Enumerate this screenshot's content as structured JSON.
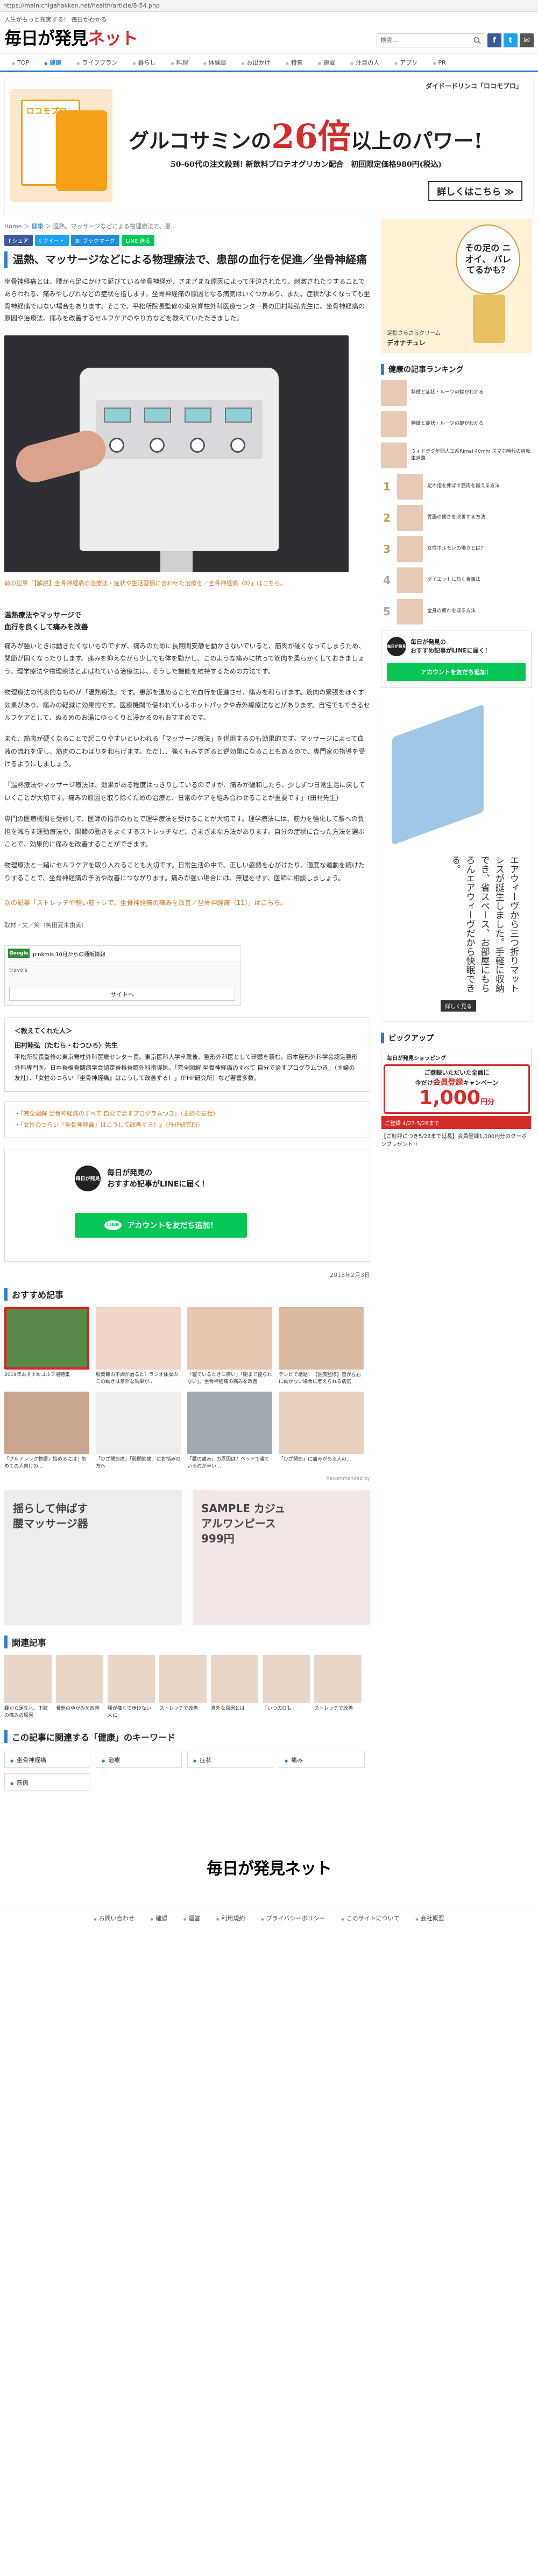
{
  "browser": {
    "url": "https://mainichigahakken.net/health/article/8-54.php"
  },
  "header": {
    "tagline": "人生がもっと充実する！ 毎日がわかる",
    "logo_main": "毎日が発見",
    "logo_accent": "ネット",
    "search_placeholder": "検索...",
    "social": [
      "f",
      "t",
      "✉"
    ]
  },
  "nav": {
    "items": [
      "TOP",
      "健康",
      "ライフプラン",
      "暮らし",
      "料理",
      "体験談",
      "お出かけ",
      "特集",
      "連載",
      "注目の人",
      "アプリ",
      "PR"
    ],
    "active_index": 1
  },
  "top_ad": {
    "brand": "ダイドードリンコ「ロコモプロ」",
    "product": "ロコモプロ",
    "headline_pre": "グルコサミンの",
    "headline_big": "26倍",
    "headline_post": "以上のパワー!",
    "sub": "50-60代の注文殺到! 新飲料プロテオグリカン配合　初回限定価格980円(税込)",
    "more": "詳しくはこちら ≫"
  },
  "breadcrumb": {
    "home": "Home",
    "sep1": "＞",
    "cat": "健康",
    "sep2": "＞",
    "current": "温熱、マッサージなどによる物理療法で、患..."
  },
  "share": {
    "buttons": [
      "f シェア",
      "t ツイート",
      "B! ブックマーク",
      "LINE 送る"
    ],
    "colors": [
      "#3b5998",
      "#1da1f2",
      "#1f8ddb",
      "#06c755"
    ]
  },
  "article": {
    "title": "温熱、マッサージなどによる物理療法で、患部の血行を促進／坐骨神経痛",
    "lead": "坐骨神経痛とは、腰から足にかけて延びている坐骨神経が、さまざまな原因によって圧迫されたり、刺激されたりすることであらわれる、痛みやしびれなどの症状を指します。坐骨神経痛の原因となる病気はいくつかあり、また、症状がよくなっても坐骨神経痛ではない場合もあります。そこで、平松所院長監修の東京脊柱外科医療センター長の田村睦弘先生に、坐骨神経痛の原因や治療法、痛みを改善するセルフケアのやり方などを教えていただきました。",
    "caption": "前の記事「【解説】坐骨神経痛の治療法・症状や生活習慣に合わせた治療を／坐骨神経痛（8）」はこちら。",
    "section_heading": "温熱療法やマッサージで\n血行を良くして痛みを改善",
    "paragraphs": [
      "痛みが強いときは動きたくないものですが、痛みのために長期間安静を動かさないでいると、筋肉が硬くなってしまうため、関節が固くなったりします。痛みを抑えながら少しでも体を動かし、このような痛みに抗って筋肉を柔らかくしておきましょう。理学療法や物理療法とよばれている治療法は、そうした機能を維持するための方法です。",
      "物理療法の代表的なものが「温熱療法」です。患部を温めることで血行を促進させ、痛みを和らげます。筋肉の緊張をほぐす効果があり、痛みの軽減に効果的です。医療機関で使われているホットパックや赤外線療法などがあります。自宅でもできるセルフケアとして、ぬるめのお湯にゆっくりと浸かるのもおすすめです。",
      "また、筋肉が硬くなることで起こりやすいといわれる「マッサージ療法」を併用するのも効果的です。マッサージによって血液の流れを促し、筋肉のこわばりを和らげます。ただし、強くもみすぎると逆効果になることもあるので、専門家の指導を受けるようにしましょう。",
      "「温熱療法やマッサージ療法は、効果がある程度はっきりしているのですが、痛みが緩和したら、少しずつ日常生活に戻していくことが大切です。痛みの原因を取り除くための治療と、日常のケアを組み合わせることが重要です」（田村先生）",
      "専門の医療機関を受診して、医師の指示のもとで理学療法を受けることが大切です。理学療法には、筋力を強化して腰への負担を減らす運動療法や、関節の動きをよくするストレッチなど、さまざまな方法があります。自分の症状に合った方法を選ぶことで、効果的に痛みを改善することができます。",
      "物理療法と一緒にセルフケアを取り入れることも大切です。日常生活の中で、正しい姿勢を心がけたり、適度な運動を続けたりすることで、坐骨神経痛の予防や改善につながります。痛みが強い場合には、無理をせず、医師に相談しましょう。"
    ],
    "next_link": "次の記事「ストレッチや軽い筋トレで、坐骨神経痛の痛みを改善／坐骨神経痛（11）」はこちら。",
    "source": "取材・文／笑（笑田夏木由美）"
  },
  "inline_ad": {
    "brand": "Google",
    "title": "pinkmis 10月からの通販情報",
    "url": "travels",
    "button": "サイトへ"
  },
  "expert": {
    "heading": "＜教えてくれた人＞",
    "name": "田村睦弘（たむら・むつひろ）先生",
    "bio": "平松所院長監修の東京脊柱外科医療センター長。東京医科大学卒業後、整形外科医として研鑽を積む。日本整形外科学会認定整形外科専門医。日本脊椎脊髄病学会認定脊椎脊髄外科指導医。「完全図解 坐骨神経痛のすべて 自分で治すプログラムつき」（主婦の友社）、「女性のつらい『坐骨神経痛』はこうして改善する！」（PHP研究所）など著書多数。"
  },
  "books": [
    "『完全図解 坐骨神経痛のすべて 自分で治すプログラムつき』（主婦の友社）",
    "『女性のつらい「坐骨神経痛」はこうして改善する！』（PHP研究所）"
  ],
  "line_box": {
    "icon": "毎日が発見",
    "text": "毎日が発見の\nおすすめ記事がLINEに届く！",
    "button": "アカウントを友だち追加！",
    "line_label": "LINE"
  },
  "date": "2018年2月3日",
  "recommend": {
    "title": "おすすめ記事",
    "items": [
      {
        "text": "2019年おすすめゴルフ場特集",
        "src": "",
        "color": "#5a8a4a"
      },
      {
        "text": "股関節の不調が治ると？ラジオ体操のこの動きは意外な効果が…",
        "src": "",
        "color": "#f0d5c8"
      },
      {
        "text": "「寝ているときに痛い」「朝まで寝られない」。坐骨神経痛の痛みを改善",
        "src": "",
        "color": "#e8c4b0"
      },
      {
        "text": "テレビで話題！【医療監修】首が左右に動かない場合に考えられる病気",
        "src": "",
        "color": "#d9b8a0"
      },
      {
        "text": "「ブルアレック物語」始めるには？初めての人向けの...",
        "src": "",
        "color": "#c9a48e"
      },
      {
        "text": "「ひざ関節痛」「股関節痛」にお悩みの方へ",
        "src": "",
        "color": "#eeeeee"
      },
      {
        "text": "「腰の痛み」の原因は？ベッドで寝ているのが辛い...",
        "src": "",
        "color": "#a0a8b0"
      },
      {
        "text": "「ひざ関節」に痛みがある人の...",
        "src": "",
        "color": "#e6d0c0"
      }
    ],
    "note": "Recommended by"
  },
  "big_ads": [
    {
      "text": "揺らして伸ばす 腰マッサージ器",
      "color": "#ededed"
    },
    {
      "text": "SAMPLE カジュアルワンピース 999円",
      "color": "#f3e6e6"
    }
  ],
  "related": {
    "title": "関連記事",
    "items": [
      "腰から足先へ。下肢の痛みの原因",
      "骨盤のゆがみを改善",
      "腰が痛くて歩けない人に",
      "ストレッチで改善",
      "意外な原因とは",
      "「いつの日も」",
      "ストレッチで改善"
    ]
  },
  "keywords": {
    "title": "この記事に関連する「健康」のキーワード",
    "items": [
      "坐骨神経痛",
      "治療",
      "症状",
      "痛み",
      "筋肉"
    ]
  },
  "sidebar": {
    "ad1": {
      "headline": "その足の ニオイ、 バレてるかも？",
      "brand": "デオナチュレ",
      "product": "足指さらさらクリーム"
    },
    "ranking_title": "健康の記事ランキング",
    "ranking_items": [
      {
        "num": "",
        "text": "特徴と症状・ルーツの鍵がわかる"
      },
      {
        "num": "",
        "text": "特徴と症状・ルーツの鍵がわかる"
      },
      {
        "num": "",
        "text": "ウォドデグ年間人工系Rimal 40mm スマホ時代の自転車道路"
      },
      {
        "num": "1",
        "text": "足の指を伸ばす筋肉を鍛える方法"
      },
      {
        "num": "2",
        "text": "胃腸の働きを改善する方法"
      },
      {
        "num": "3",
        "text": "女性ホルモンの働きとは？"
      },
      {
        "num": "4",
        "text": "ダイエットに効く食事法"
      },
      {
        "num": "5",
        "text": "全身の疲れを取る方法"
      }
    ],
    "line": {
      "icon": "毎日が発見",
      "text": "毎日が発見の\nおすすめ記事がLINEに届く！",
      "button": "アカウントを友だち追加！"
    },
    "ad2": {
      "vertical_text": "エアウィーヴから三つ折りマットレスが誕生しました。手軽に収納でき、省スペース、お部屋にもちろんエアウィーヴだから快眠できる。",
      "button": "詳しく見る"
    },
    "pickup_title": "ピックアップ",
    "pickup": {
      "top": "毎日が発見ショッピング",
      "line1": "ご登録いただいた全員に",
      "line2_pre": "今だけ",
      "line2_red": "会員登録",
      "line2_post": "キャンペーン",
      "amount": "1,000",
      "amount_unit": "円分",
      "bar": "ご登録 4/27-5/28まで",
      "caption": "【ご好評につき5/28まで延長】会員登録1,000円分のクーポンプレゼント!!"
    }
  },
  "footer": {
    "logo": "毎日が発見ネット",
    "links": [
      "お問い合わせ",
      "確認",
      "運営",
      "利用規約",
      "プライバシーポリシー",
      "このサイトについて",
      "会社概要"
    ]
  }
}
